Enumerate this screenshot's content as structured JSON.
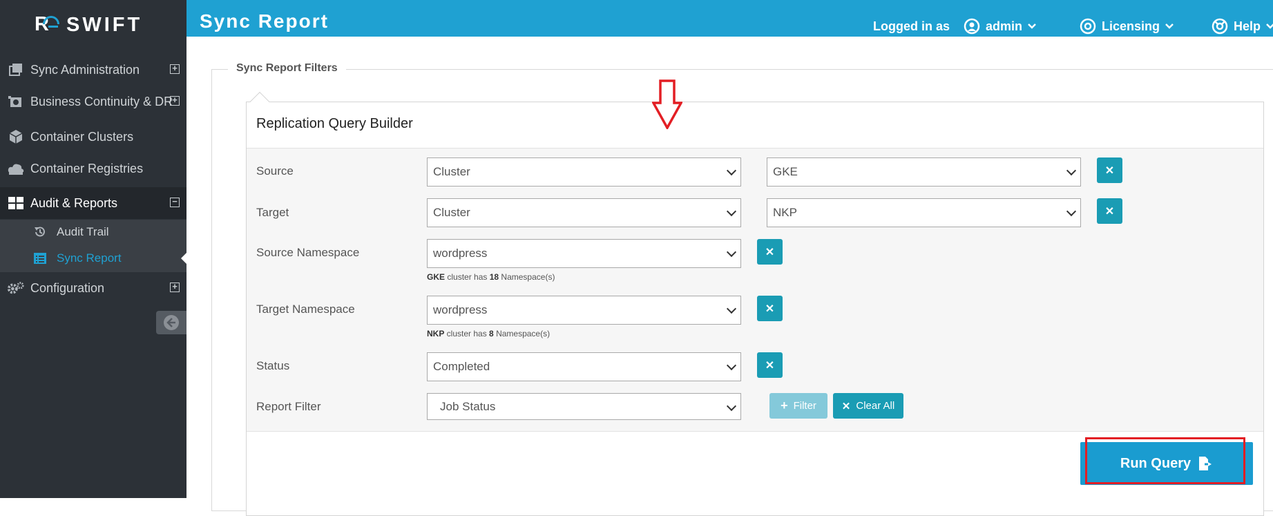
{
  "app": {
    "name": "SWIFT"
  },
  "sidebar": {
    "items": [
      {
        "label": "Sync Administration",
        "icon": "copy-icon",
        "expand": "+"
      },
      {
        "label": "Business Continuity & DR",
        "icon": "dr-icon",
        "expand": "+"
      },
      {
        "label": "Container Clusters",
        "icon": "cube-icon"
      },
      {
        "label": "Container Registries",
        "icon": "cloud-storage-icon"
      },
      {
        "label": "Audit & Reports",
        "icon": "table-icon",
        "expand": "−"
      },
      {
        "label": "Configuration",
        "icon": "gears-icon",
        "expand": "+"
      }
    ],
    "subitems": [
      {
        "label": "Audit Trail",
        "icon": "history-icon"
      },
      {
        "label": "Sync Report",
        "icon": "list-icon"
      }
    ]
  },
  "header": {
    "title": "Sync Report",
    "logged_in_as": "Logged in as",
    "user": "admin",
    "licensing": "Licensing",
    "help": "Help"
  },
  "filters": {
    "legend": "Sync Report Filters",
    "panel_title": "Replication Query Builder",
    "rows": {
      "source": {
        "label": "Source",
        "type": "Cluster",
        "value": "GKE"
      },
      "target": {
        "label": "Target",
        "type": "Cluster",
        "value": "NKP"
      },
      "source_ns": {
        "label": "Source Namespace",
        "value": "wordpress",
        "hint_cluster": "GKE",
        "hint_mid": " cluster has ",
        "hint_count": "18",
        "hint_tail": " Namespace(s)"
      },
      "target_ns": {
        "label": "Target Namespace",
        "value": "wordpress",
        "hint_cluster": "NKP",
        "hint_mid": " cluster has ",
        "hint_count": "8",
        "hint_tail": " Namespace(s)"
      },
      "status": {
        "label": "Status",
        "value": "Completed"
      },
      "report_filter": {
        "label": "Report Filter",
        "value": "Job Status"
      }
    },
    "filter_button": "Filter",
    "clear_button": "Clear All",
    "run_button": "Run Query"
  },
  "colors": {
    "accent": "#1fa1d2",
    "sidebar": "#2c3137",
    "highlight": "#e31e24",
    "button": "#1a9cb4"
  }
}
